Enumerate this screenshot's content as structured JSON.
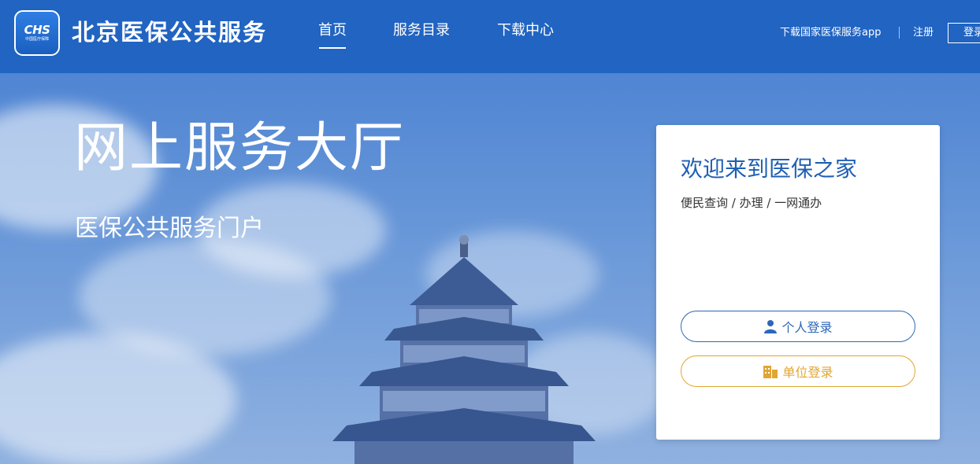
{
  "header": {
    "logo": {
      "mark": "CHS",
      "sub": "中国医疗保障"
    },
    "site_title": "北京医保公共服务",
    "nav": [
      {
        "label": "首页",
        "active": true
      },
      {
        "label": "服务目录",
        "active": false
      },
      {
        "label": "下载中心",
        "active": false
      }
    ],
    "download_app_link": "下载国家医保服务app",
    "register_link": "注册",
    "login_button": "登录"
  },
  "hero": {
    "title": "网上服务大厅",
    "subtitle": "医保公共服务门户"
  },
  "welcome_card": {
    "title": "欢迎来到医保之家",
    "subtitle": "便民查询 / 办理 / 一网通办",
    "personal_login": "个人登录",
    "company_login": "单位登录"
  },
  "colors": {
    "header_bg": "#2164c2",
    "accent_blue": "#2e67b8",
    "accent_orange": "#e2a531"
  }
}
